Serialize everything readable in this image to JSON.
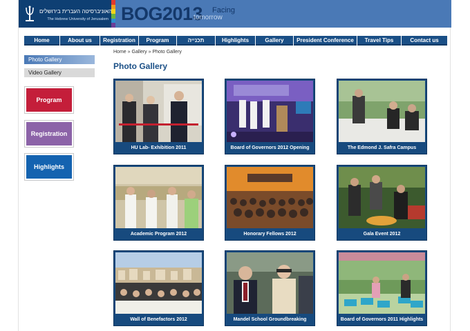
{
  "header": {
    "hebrew_university_name": "האוניברסיטה העברית בירושלים",
    "english_university_name": "The Hebrew University of Jerusalem",
    "event_title": "BOG2013",
    "tagline_word1": "Facing",
    "tagline_word2": "tomorrow"
  },
  "nav": {
    "items": [
      {
        "label": "Home"
      },
      {
        "label": "About us"
      },
      {
        "label": "Registration"
      },
      {
        "label": "Program"
      },
      {
        "label": "תכנייה"
      },
      {
        "label": "Highlights"
      },
      {
        "label": "Gallery"
      },
      {
        "label": "President Conference"
      },
      {
        "label": "Travel Tips"
      },
      {
        "label": "Contact us"
      }
    ]
  },
  "breadcrumb": {
    "home": "Home",
    "sep1": "»",
    "gallery": "Gallery",
    "sep2": "»",
    "current": "Photo Gallery"
  },
  "sidebar": {
    "tabs": [
      {
        "label": "Photo Gallery",
        "active": true
      },
      {
        "label": "Video Gallery",
        "active": false
      }
    ],
    "buttons": [
      {
        "label": "Program",
        "color": "#c41e3a"
      },
      {
        "label": "Registration",
        "color": "#8c63a8"
      },
      {
        "label": "Highlights",
        "color": "#1463b0"
      }
    ]
  },
  "gallery": {
    "title": "Photo Gallery",
    "items": [
      {
        "caption": "HU Lab- Exhibition 2011"
      },
      {
        "caption": "Board of Governors 2012 Opening"
      },
      {
        "caption": "The Edmond J. Safra Campus"
      },
      {
        "caption": "Academic Program 2012"
      },
      {
        "caption": "Honorary Fellows 2012"
      },
      {
        "caption": "Gala Event 2012"
      },
      {
        "caption": "Wall of Benefactors 2012"
      },
      {
        "caption": "Mandel School Groundbreaking"
      },
      {
        "caption": "Board of Governors 2011 Highlights"
      }
    ]
  },
  "colors": {
    "header_bg": "#4a79b6",
    "logo_bg": "#0e3f73",
    "nav_bg": "#1a4f86",
    "title_blue": "#1a4f86",
    "program_red": "#c41e3a",
    "registration_purple": "#8c63a8",
    "highlights_blue": "#1463b0"
  }
}
